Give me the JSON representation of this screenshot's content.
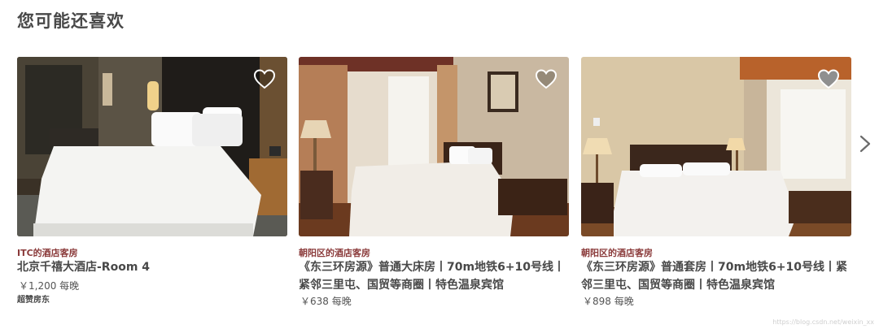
{
  "section_title": "您可能还喜欢",
  "watermark": "https://blog.csdn.net/weixin_xx",
  "cards": [
    {
      "type_label": "ITC的酒店客房",
      "title": "北京千禧大酒店-Room 4",
      "price": "￥1,200 每晚",
      "badge": "超赞房东",
      "heart_icon": "heart-outline-icon"
    },
    {
      "type_label": "朝阳区的酒店客房",
      "title": "《东三环房源》普通大床房丨70m地铁6+10号线丨紧邻三里屯、国贸等商圈丨特色温泉宾馆",
      "price": "￥638 每晚",
      "heart_icon": "heart-outline-icon"
    },
    {
      "type_label": "朝阳区的酒店客房",
      "title": "《东三环房源》普通套房丨70m地铁6+10号线丨紧邻三里屯、国贸等商圈丨特色温泉宾馆",
      "price": "￥898 每晚",
      "heart_icon": "heart-filled-icon"
    }
  ],
  "next_icon": "chevron-right-icon"
}
